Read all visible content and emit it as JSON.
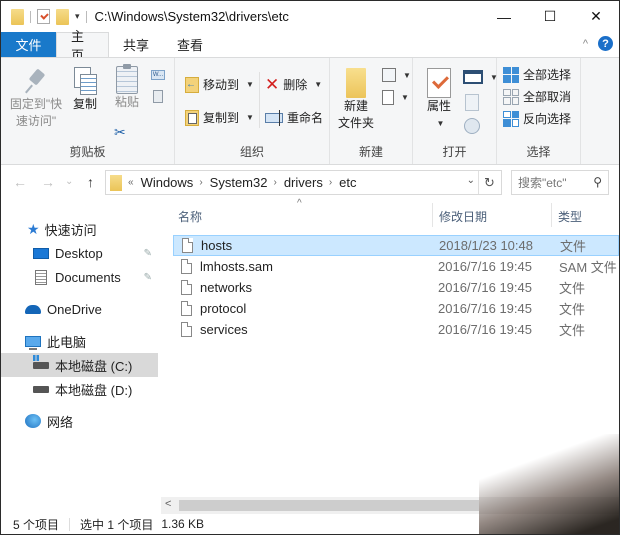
{
  "window": {
    "title": "C:\\Windows\\System32\\drivers\\etc",
    "controls": {
      "minimize": "—",
      "maximize": "☐",
      "close": "✕"
    }
  },
  "quick_access_toolbar": {
    "dropdown": "▾"
  },
  "tabs": [
    {
      "label": "文件"
    },
    {
      "label": "主页"
    },
    {
      "label": "共享"
    },
    {
      "label": "查看"
    }
  ],
  "tabs_right": {
    "collapse": "^",
    "help": "?"
  },
  "ribbon": {
    "clipboard": {
      "label": "剪贴板",
      "pin_label_1": "固定到\"快",
      "pin_label_2": "速访问\"",
      "copy_label": "复制",
      "paste_label": "粘贴",
      "copy_path_icon_text": "W..."
    },
    "organize": {
      "label": "组织",
      "move_to": "移动到",
      "copy_to": "复制到",
      "delete": "删除",
      "rename": "重命名"
    },
    "new": {
      "label": "新建",
      "new_folder_1": "新建",
      "new_folder_2": "文件夹"
    },
    "open": {
      "label": "打开",
      "properties": "属性"
    },
    "select": {
      "label": "选择",
      "select_all": "全部选择",
      "select_none": "全部取消",
      "invert": "反向选择"
    }
  },
  "navigation": {
    "back": "←",
    "forward": "→",
    "recent": "⌄",
    "up": "↑",
    "breadcrumb_overflow": "«",
    "breadcrumb": [
      "Windows",
      "System32",
      "drivers",
      "etc"
    ],
    "crumb_sep": "›",
    "dropdown": "⌄",
    "refresh": "↻",
    "search_placeholder": "搜索\"etc\"",
    "search_icon": "⚲"
  },
  "sidebar": {
    "items": [
      {
        "label": "快速访问",
        "icon": "star-icon"
      },
      {
        "label": "Desktop",
        "icon": "desktop-icon",
        "pinned": true
      },
      {
        "label": "Documents",
        "icon": "documents-icon",
        "pinned": true
      },
      {
        "label": "OneDrive",
        "icon": "onedrive-icon"
      },
      {
        "label": "此电脑",
        "icon": "this-pc-icon"
      },
      {
        "label": "本地磁盘 (C:)",
        "icon": "drive-icon",
        "selected": true
      },
      {
        "label": "本地磁盘 (D:)",
        "icon": "drive-icon"
      },
      {
        "label": "网络",
        "icon": "network-icon"
      }
    ],
    "pin_glyph": "📌"
  },
  "filelist": {
    "sort_indicator": "^",
    "columns": [
      "名称",
      "修改日期",
      "类型"
    ],
    "rows": [
      {
        "name": "hosts",
        "date": "2018/1/23 10:48",
        "type": "文件",
        "selected": true
      },
      {
        "name": "lmhosts.sam",
        "date": "2016/7/16 19:45",
        "type": "SAM 文件"
      },
      {
        "name": "networks",
        "date": "2016/7/16 19:45",
        "type": "文件"
      },
      {
        "name": "protocol",
        "date": "2016/7/16 19:45",
        "type": "文件"
      },
      {
        "name": "services",
        "date": "2016/7/16 19:45",
        "type": "文件"
      }
    ]
  },
  "hscroll": {
    "left_arrow": "<"
  },
  "status": {
    "item_count": "5 个项目",
    "selected": "选中 1 个项目",
    "size": "1.36 KB"
  }
}
